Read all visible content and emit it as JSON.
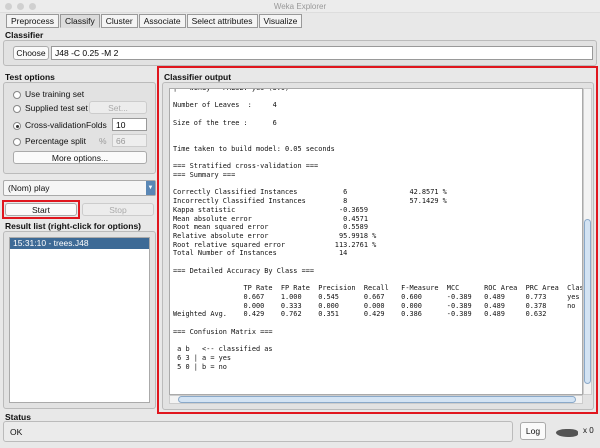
{
  "window": {
    "title": "Weka Explorer"
  },
  "tabs": [
    "Preprocess",
    "Classify",
    "Cluster",
    "Associate",
    "Select attributes",
    "Visualize"
  ],
  "classifier": {
    "label": "Classifier",
    "choose": "Choose",
    "value": "J48 -C 0.25 -M 2"
  },
  "test_options": {
    "label": "Test options",
    "use_training": "Use training set",
    "supplied": "Supplied test set",
    "set_btn": "Set...",
    "cv": "Cross-validation",
    "folds_label": "Folds",
    "folds": "10",
    "pct": "Percentage split",
    "pct_sym": "%",
    "pct_val": "66",
    "more": "More options...",
    "selected": "Cross-validation"
  },
  "class_select": "(Nom) play",
  "start": "Start",
  "stop": "Stop",
  "result_list": {
    "label": "Result list (right-click for options)",
    "items": [
      "15:31:10 - trees.J48"
    ]
  },
  "output": {
    "label": "Classifier output",
    "lines": [
      "|   windy = FALSE: yes (3.0)",
      "",
      "Number of Leaves  :     4",
      "",
      "Size of the tree :      6",
      "",
      "",
      "Time taken to build model: 0.05 seconds",
      "",
      "=== Stratified cross-validation ===",
      "=== Summary ===",
      "",
      "Correctly Classified Instances           6               42.8571 %",
      "Incorrectly Classified Instances         8               57.1429 %",
      "Kappa statistic                         -0.3659",
      "Mean absolute error                      0.4571",
      "Root mean squared error                  0.5589",
      "Relative absolute error                 95.9918 %",
      "Root relative squared error            113.2761 %",
      "Total Number of Instances               14",
      "",
      "=== Detailed Accuracy By Class ===",
      "",
      "                 TP Rate  FP Rate  Precision  Recall   F-Measure  MCC      ROC Area  PRC Area  Class",
      "                 0.667    1.000    0.545      0.667    0.600      -0.389   0.489     0.773     yes",
      "                 0.000    0.333    0.000      0.000    0.000      -0.389   0.489     0.378     no",
      "Weighted Avg.    0.429    0.762    0.351      0.429    0.386      -0.389   0.489     0.632",
      "",
      "=== Confusion Matrix ===",
      "",
      " a b   <-- classified as",
      " 6 3 | a = yes",
      " 5 0 | b = no"
    ]
  },
  "status": {
    "label": "Status",
    "text": "OK",
    "log": "Log",
    "count": "x 0"
  },
  "colors": {
    "highlight": "#e0161e",
    "selection": "#3d6a96"
  }
}
